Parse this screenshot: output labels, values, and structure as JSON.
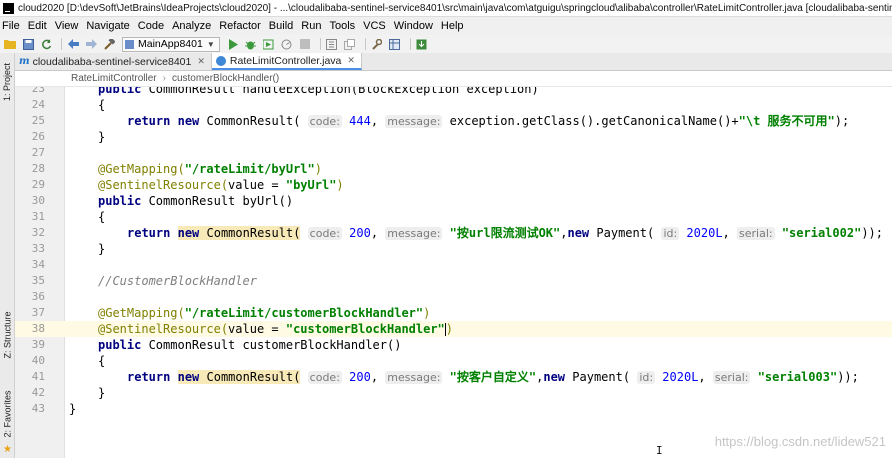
{
  "window": {
    "title": "cloud2020 [D:\\devSoft\\JetBrains\\IdeaProjects\\cloud2020] - ...\\cloudalibaba-sentinel-service8401\\src\\main\\java\\com\\atguigu\\springcloud\\alibaba\\controller\\RateLimitController.java [cloudalibaba-sentinel-se..."
  },
  "menu": [
    "File",
    "Edit",
    "View",
    "Navigate",
    "Code",
    "Analyze",
    "Refactor",
    "Build",
    "Run",
    "Tools",
    "VCS",
    "Window",
    "Help"
  ],
  "toolbar": {
    "run_config": "MainApp8401"
  },
  "side_tabs": {
    "project": "1: Project",
    "structure": "Z: Structure",
    "favorites": "2: Favorites"
  },
  "tabs": [
    {
      "label": "cloudalibaba-sentinel-service8401",
      "active": false
    },
    {
      "label": "RateLimitController.java",
      "active": true
    }
  ],
  "breadcrumb": [
    "RateLimitController",
    "customerBlockHandler()"
  ],
  "editor": {
    "lines": [
      {
        "n": "23",
        "t1": "public",
        "t2": " CommonResult handleException(BlockException exception)"
      },
      {
        "n": "24",
        "t1": "{"
      },
      {
        "n": "25",
        "t1": "return",
        "t2": "new",
        "t3": " CommonResult(",
        "h1": "code:",
        "t4": "444",
        "t5": ", ",
        "h2": "message:",
        "t6": " exception.getClass().getCanonicalName()+",
        "s1": "\"\\t 服务不可用\"",
        "t7": ");"
      },
      {
        "n": "26",
        "t1": "}"
      },
      {
        "n": "27"
      },
      {
        "n": "28",
        "a1": "@GetMapping(",
        "s1": "\"/rateLimit/byUrl\"",
        "a2": ")"
      },
      {
        "n": "29",
        "a1": "@SentinelResource(",
        "t1": "value = ",
        "s1": "\"byUrl\"",
        "a2": ")"
      },
      {
        "n": "30",
        "t1": "public",
        "t2": " CommonResult byUrl()"
      },
      {
        "n": "31",
        "t1": "{"
      },
      {
        "n": "32",
        "t1": "return",
        "t2": "new",
        "t3": " CommonResult(",
        "h1": "code:",
        "t4": "200",
        "t5": ", ",
        "h2": "message:",
        "s1": "\"按url限流测试OK\"",
        "t6": ",",
        "t7": "new",
        "t8": " Payment(",
        "h3": "id:",
        "t9": "2020L",
        "t10": ", ",
        "h4": "serial:",
        "s2": "\"serial002\"",
        "t11": "));"
      },
      {
        "n": "33",
        "t1": "}"
      },
      {
        "n": "34"
      },
      {
        "n": "35",
        "c1": "//CustomerBlockHandler"
      },
      {
        "n": "36"
      },
      {
        "n": "37",
        "a1": "@GetMapping(",
        "s1": "\"/rateLimit/customerBlockHandler\"",
        "a2": ")"
      },
      {
        "n": "38",
        "a1": "@SentinelResource(",
        "t1": "value = ",
        "s1": "\"customerBlockHandler\"",
        "a2": ")"
      },
      {
        "n": "39",
        "t1": "public",
        "t2": " CommonResult customerBlockHandler()"
      },
      {
        "n": "40",
        "t1": "{"
      },
      {
        "n": "41",
        "t1": "return",
        "t2": "new",
        "t3": " CommonResult(",
        "h1": "code:",
        "t4": "200",
        "t5": ", ",
        "h2": "message:",
        "s1": "\"按客户自定义\"",
        "t6": ",",
        "t7": "new",
        "t8": " Payment(",
        "h3": "id:",
        "t9": "2020L",
        "t10": ", ",
        "h4": "serial:",
        "s2": "\"serial003\"",
        "t11": "));"
      },
      {
        "n": "42",
        "t1": "}"
      },
      {
        "n": "43",
        "t1": "}"
      }
    ]
  },
  "watermark": "https://blog.csdn.net/lidew521",
  "colors": {
    "keyword": "#000080",
    "string": "#008000",
    "annotation": "#808000",
    "comment": "#808080",
    "current_line": "#fffae3",
    "tab_accent": "#4a8ee6"
  }
}
